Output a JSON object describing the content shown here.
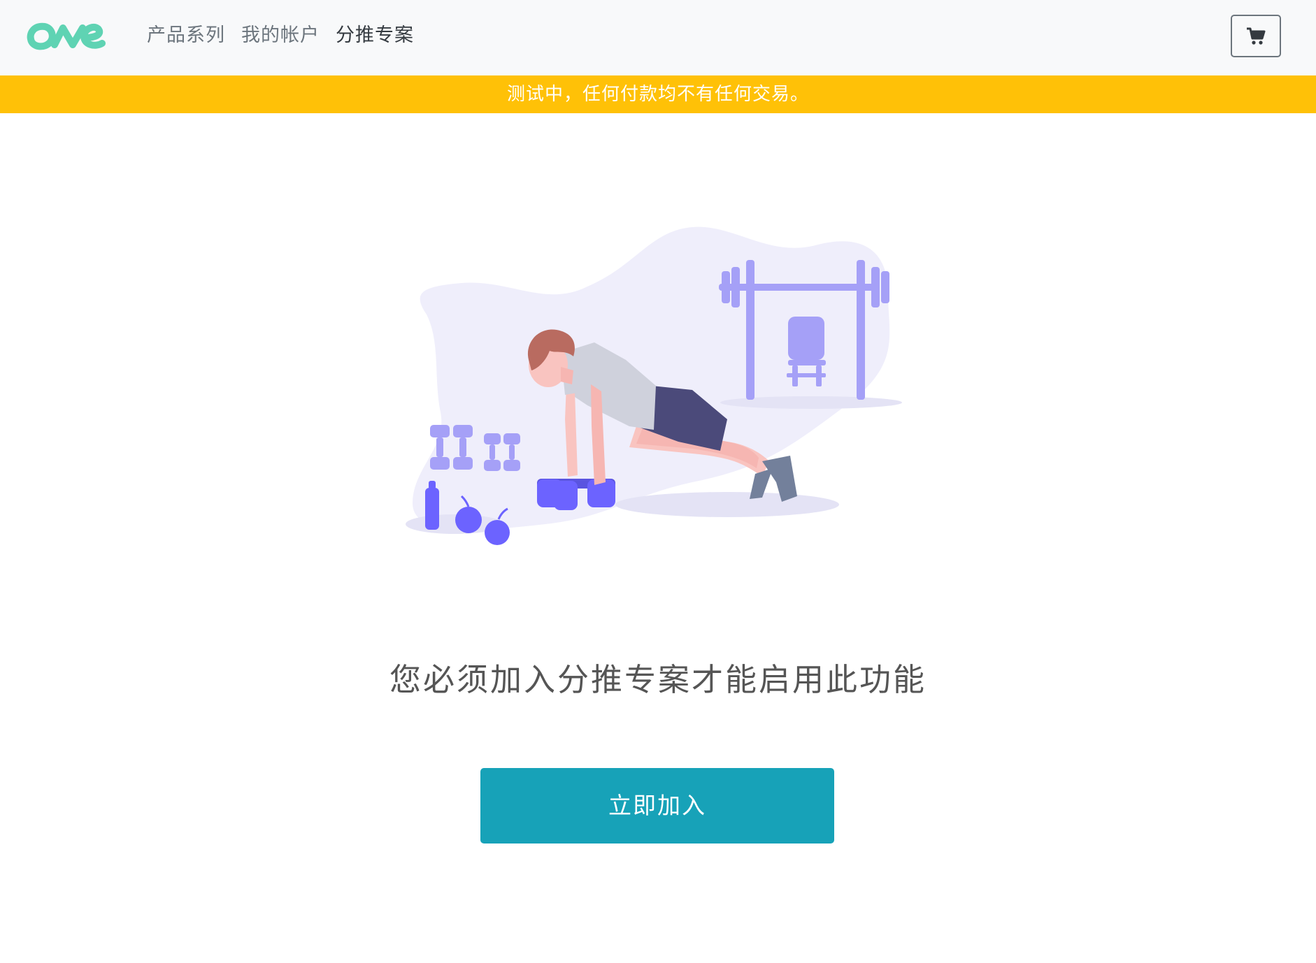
{
  "navbar": {
    "brand": "ONE",
    "brand_color": "#5fd3b3",
    "links": [
      {
        "label": "产品系列",
        "active": false
      },
      {
        "label": "我的帐户",
        "active": false
      },
      {
        "label": "分推专案",
        "active": true
      }
    ],
    "cart_icon": "shopping-cart-icon"
  },
  "notice": {
    "text": "测试中，任何付款均不有任何交易。",
    "color": "#ffc107"
  },
  "main": {
    "illustration": "person-doing-pushups-gym-illustration",
    "message": "您必须加入分推专案才能启用此功能",
    "join_button_label": "立即加入",
    "button_color": "#17a2b8"
  }
}
